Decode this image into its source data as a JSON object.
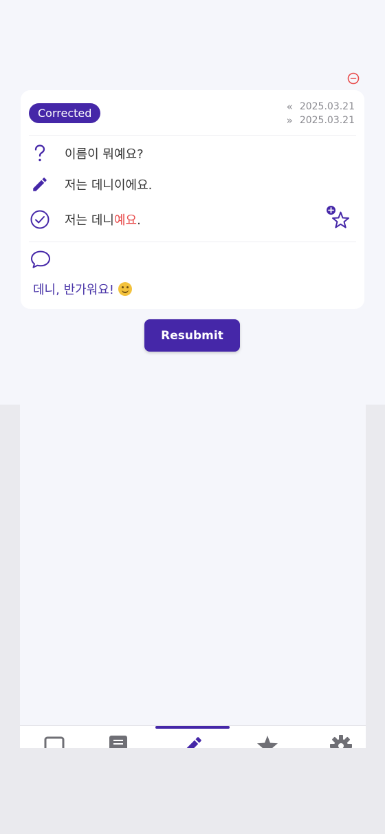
{
  "colors": {
    "accent": "#4527a8",
    "highlight": "#e84b4b",
    "delete": "#e84b4b",
    "muted": "#8a8a90"
  },
  "entry": {
    "status_badge": "Corrected",
    "date_created": "2025.03.21",
    "date_corrected": "2025.03.21",
    "question": "이름이 뭐예요?",
    "answer": "저는 데니이에요.",
    "correction_prefix": "저는 데니",
    "correction_highlight": "예요",
    "correction_suffix": ".",
    "comment": "데니, 반가워요!"
  },
  "icons": {
    "delete": "minus-circle-icon",
    "date_created": "double-left-arrow-icon",
    "date_corrected": "double-right-arrow-icon",
    "question": "question-mark-icon",
    "answer": "pencil-icon",
    "correction": "check-circle-icon",
    "favorite": "add-star-icon",
    "comment": "speech-bubble-icon",
    "emoji": "smiling-face-emoji"
  },
  "actions": {
    "resubmit_label": "Resubmit"
  },
  "tabbar": {
    "tabs": [
      {
        "icon": "square-icon",
        "active": false
      },
      {
        "icon": "note-icon",
        "active": false
      },
      {
        "icon": "pencil-icon",
        "active": true
      },
      {
        "icon": "star-icon",
        "active": false
      },
      {
        "icon": "gear-icon",
        "active": false
      }
    ]
  }
}
